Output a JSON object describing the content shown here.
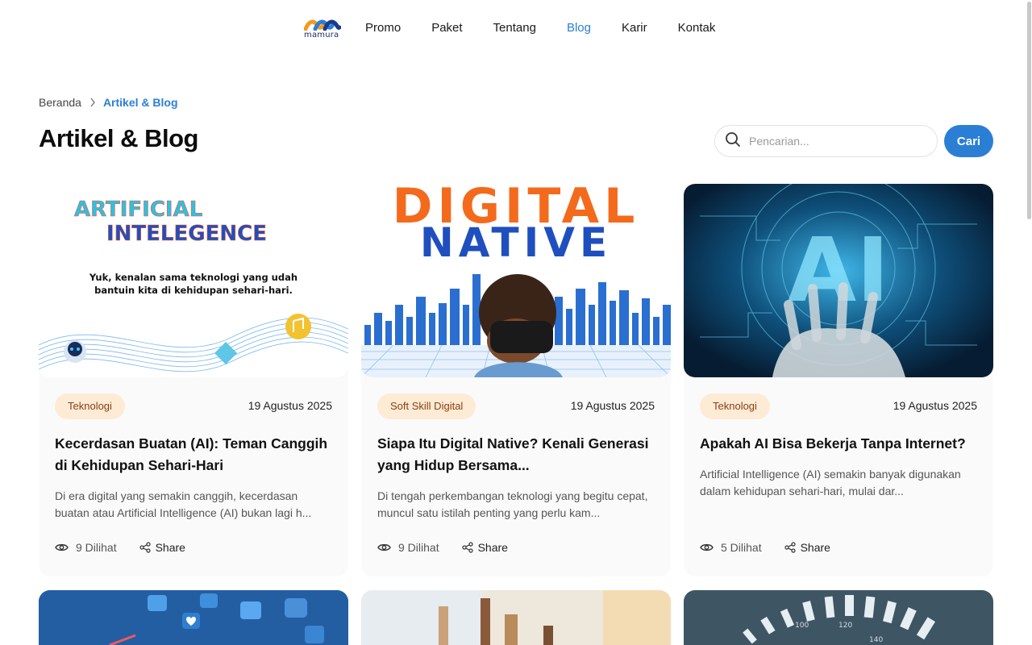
{
  "logo": {
    "text": "mamura"
  },
  "nav": {
    "items": [
      {
        "label": "Promo"
      },
      {
        "label": "Paket"
      },
      {
        "label": "Tentang"
      },
      {
        "label": "Blog"
      },
      {
        "label": "Karir"
      },
      {
        "label": "Kontak"
      }
    ],
    "active": "Blog"
  },
  "breadcrumb": {
    "home": "Beranda",
    "current": "Artikel & Blog"
  },
  "page": {
    "title": "Artikel & Blog"
  },
  "search": {
    "placeholder": "Pencarian...",
    "button_label": "Cari"
  },
  "colors": {
    "accent": "#2a7fd4",
    "tag_bg": "#fdebd6",
    "tag_text": "#8a3f10"
  },
  "cards": [
    {
      "image": {
        "line1": "ARTIFICIAL",
        "line2": "INTELEGENCE",
        "sub1": "Yuk, kenalan sama teknologi yang udah",
        "sub2": "bantuin kita di kehidupan sehari-hari."
      },
      "tag": "Teknologi",
      "date": "19 Agustus 2025",
      "title": "Kecerdasan Buatan (AI): Teman Canggih di Kehidupan Sehari-Hari",
      "desc": "Di era digital yang semakin canggih, kecerdasan buatan atau Artificial Intelligence (AI) bukan lagi h...",
      "views": "9 Dilihat",
      "share": "Share"
    },
    {
      "image": {
        "line1": "DIGITAL",
        "line2": "NATIVE"
      },
      "tag": "Soft Skill Digital",
      "date": "19 Agustus 2025",
      "title": "Siapa Itu Digital Native? Kenali Generasi yang Hidup Bersama...",
      "desc": "Di tengah perkembangan teknologi yang begitu cepat, muncul satu istilah penting yang perlu kam...",
      "views": "9 Dilihat",
      "share": "Share"
    },
    {
      "image": {
        "line1": "AI"
      },
      "tag": "Teknologi",
      "date": "19 Agustus 2025",
      "title": "Apakah AI Bisa Bekerja Tanpa Internet?",
      "desc": "Artificial Intelligence (AI) semakin banyak digunakan dalam kehidupan sehari-hari, mulai dar...",
      "views": "5 Dilihat",
      "share": "Share"
    }
  ],
  "speedometer": {
    "ticks": [
      "100",
      "120",
      "140"
    ]
  }
}
